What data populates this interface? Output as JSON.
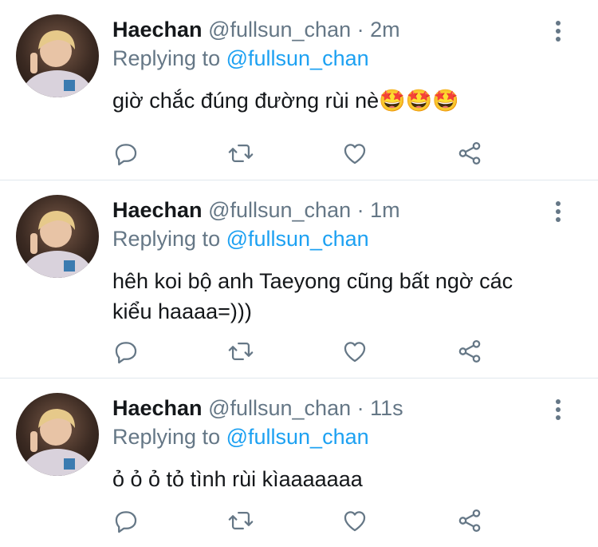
{
  "colors": {
    "name": "#14171a",
    "secondary": "#657786",
    "link": "#1da1f2",
    "divider": "#e1e8ed"
  },
  "tweets": [
    {
      "name": "Haechan",
      "handle": "@fullsun_chan",
      "separator": "·",
      "time": "2m",
      "replying_prefix": "Replying to ",
      "replying_to": "@fullsun_chan",
      "text": "giờ chắc đúng đường rùi nè🤩🤩🤩",
      "icons": [
        "reply-icon",
        "retweet-icon",
        "like-icon",
        "share-icon",
        "more-icon"
      ]
    },
    {
      "name": "Haechan",
      "handle": "@fullsun_chan",
      "separator": "·",
      "time": "1m",
      "replying_prefix": "Replying to ",
      "replying_to": "@fullsun_chan",
      "text": "hêh koi bộ anh Taeyong cũng bất ngờ các kiểu haaaa=)))",
      "icons": [
        "reply-icon",
        "retweet-icon",
        "like-icon",
        "share-icon",
        "more-icon"
      ]
    },
    {
      "name": "Haechan",
      "handle": "@fullsun_chan",
      "separator": "·",
      "time": "11s",
      "replying_prefix": "Replying to ",
      "replying_to": "@fullsun_chan",
      "text": "ỏ ỏ ỏ tỏ tình rùi kìaaaaaaa",
      "icons": [
        "reply-icon",
        "retweet-icon",
        "like-icon",
        "share-icon",
        "more-icon"
      ]
    }
  ]
}
